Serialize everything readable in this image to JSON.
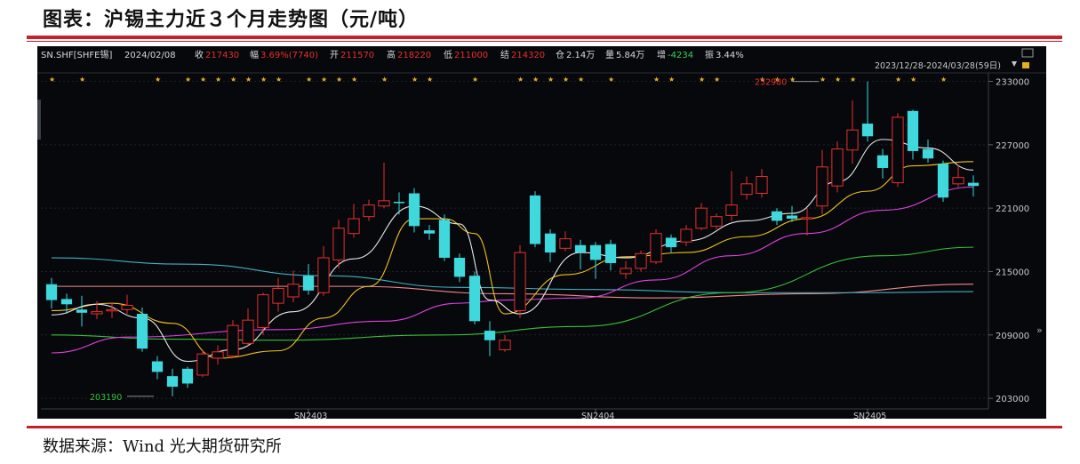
{
  "page": {
    "title": "图表：沪锡主力近３个月走势图（元/吨）",
    "source": "数据来源：Wind 光大期货研究所"
  },
  "infobar": {
    "symbol": "SN.SHF[SHFE锡]",
    "date": "2024/02/08",
    "close_label": "收",
    "close": "217430",
    "amp_label": "幅",
    "amp": "3.69%(7740)",
    "open_label": "开",
    "open": "211570",
    "high_label": "高",
    "high": "218220",
    "low_label": "低",
    "low": "211000",
    "settle_label": "结",
    "settle": "214320",
    "oi_label": "仓",
    "oi": "2.14万",
    "vol_label": "量",
    "vol": "5.84万",
    "chg_label": "增",
    "chg": "-4234",
    "swing_label": "振",
    "swing": "3.44%",
    "range": "2023/12/28-2024/03/28(59日)"
  },
  "colors": {
    "up": "#e8302c",
    "down": "#3fd8dc",
    "ma5": "#e8e8e8",
    "ma10": "#f0c020",
    "ma20": "#e040e0",
    "ma40": "#38c038",
    "ma60": "#44b0c0",
    "ma120": "#f08a8a"
  },
  "chart_data": {
    "type": "candlestick",
    "ylim": [
      202000,
      233800
    ],
    "yticks": [
      "233000",
      "227000",
      "221000",
      "215000",
      "209000",
      "203000"
    ],
    "contract_labels": [
      {
        "label": "SN2403",
        "at_index": 17
      },
      {
        "label": "SN2404",
        "at_index": 36
      },
      {
        "label": "SN2405",
        "at_index": 54
      }
    ],
    "annotations": [
      {
        "text": "232980",
        "index": 51,
        "value": 232980
      },
      {
        "text": "203190",
        "index": 7,
        "value": 203190
      }
    ],
    "candles": [
      [
        213800,
        212300,
        214400,
        211500
      ],
      [
        212400,
        211900,
        212900,
        211000
      ],
      [
        211400,
        211100,
        212700,
        209800
      ],
      [
        211000,
        211200,
        212200,
        210500
      ],
      [
        211300,
        211400,
        212100,
        210600
      ],
      [
        211400,
        211800,
        212800,
        211000
      ],
      [
        211000,
        207700,
        211600,
        207400
      ],
      [
        206500,
        205500,
        207000,
        204800
      ],
      [
        205100,
        204100,
        205800,
        203190
      ],
      [
        205800,
        204400,
        206000,
        204000
      ],
      [
        205200,
        207200,
        207600,
        205000
      ],
      [
        206800,
        207400,
        208000,
        206200
      ],
      [
        207000,
        209900,
        210400,
        206800
      ],
      [
        208200,
        210400,
        211500,
        208000
      ],
      [
        209700,
        212800,
        213000,
        209000
      ],
      [
        212000,
        213400,
        214400,
        211200
      ],
      [
        212600,
        213800,
        215100,
        212100
      ],
      [
        214600,
        213200,
        215700,
        212800
      ],
      [
        213000,
        216300,
        217400,
        212700
      ],
      [
        216100,
        219100,
        219900,
        215300
      ],
      [
        218600,
        220000,
        221400,
        218200
      ],
      [
        220200,
        221300,
        221800,
        219800
      ],
      [
        221200,
        221700,
        225300,
        221000
      ],
      [
        221600,
        221500,
        222500,
        220400
      ],
      [
        222400,
        219300,
        222900,
        218700
      ],
      [
        218900,
        218600,
        219400,
        218000
      ],
      [
        219900,
        216300,
        220400,
        216000
      ],
      [
        216300,
        214500,
        216700,
        214000
      ],
      [
        214600,
        210300,
        215000,
        210000
      ],
      [
        209400,
        208500,
        210300,
        207000
      ],
      [
        207600,
        208500,
        209000,
        207400
      ],
      [
        211300,
        216800,
        217500,
        210600
      ],
      [
        222200,
        217600,
        222600,
        217300
      ],
      [
        218600,
        216800,
        219000,
        215900
      ],
      [
        217200,
        218100,
        218800,
        216900
      ],
      [
        217500,
        216800,
        218000,
        215200
      ],
      [
        217500,
        216100,
        217800,
        214300
      ],
      [
        217600,
        215800,
        218000,
        215100
      ],
      [
        214800,
        215300,
        216000,
        214300
      ],
      [
        215300,
        216700,
        217000,
        215000
      ],
      [
        215900,
        218600,
        219000,
        215700
      ],
      [
        218200,
        217300,
        218500,
        216800
      ],
      [
        217800,
        219000,
        219400,
        217400
      ],
      [
        219100,
        221000,
        221500,
        218900
      ],
      [
        219300,
        220200,
        220500,
        219000
      ],
      [
        220300,
        221300,
        224500,
        219800
      ],
      [
        222300,
        223300,
        224000,
        221800
      ],
      [
        222400,
        224000,
        224700,
        222000
      ],
      [
        220700,
        219800,
        221000,
        219400
      ],
      [
        220300,
        220000,
        221200,
        219700
      ],
      [
        220100,
        220100,
        221000,
        218400
      ],
      [
        221200,
        224900,
        226500,
        220400
      ],
      [
        223100,
        226600,
        227300,
        222500
      ],
      [
        226500,
        228400,
        231200,
        225200
      ],
      [
        229000,
        227800,
        232980,
        227300
      ],
      [
        226000,
        224800,
        226600,
        223800
      ],
      [
        223400,
        229600,
        230000,
        223000
      ],
      [
        230200,
        226400,
        230300,
        225600
      ],
      [
        226600,
        225700,
        227500,
        225300
      ],
      [
        225200,
        222000,
        225500,
        221600
      ],
      [
        223300,
        223900,
        225100,
        223000
      ],
      [
        223400,
        223100,
        224100,
        222100
      ]
    ],
    "ma_lines": [
      {
        "name": "MA5",
        "color_key": "ma5"
      },
      {
        "name": "MA10",
        "color_key": "ma10"
      },
      {
        "name": "MA20",
        "color_key": "ma20"
      },
      {
        "name": "MA40",
        "color_key": "ma40"
      },
      {
        "name": "MA60",
        "color_key": "ma60"
      },
      {
        "name": "MA120",
        "color_key": "ma120"
      }
    ],
    "ma60_values": [
      [
        0,
        216300
      ],
      [
        9,
        215700
      ],
      [
        18,
        214600
      ],
      [
        27,
        213500
      ],
      [
        36,
        213300
      ],
      [
        45,
        213000
      ],
      [
        54,
        213000
      ],
      [
        61,
        213100
      ]
    ],
    "ma120_values": [
      [
        0,
        213600
      ],
      [
        20,
        213600
      ],
      [
        30,
        212900
      ],
      [
        40,
        212500
      ],
      [
        50,
        212900
      ],
      [
        61,
        213800
      ]
    ],
    "ma40_values": [
      [
        0,
        209000
      ],
      [
        8,
        208600
      ],
      [
        15,
        208500
      ],
      [
        26,
        209000
      ],
      [
        35,
        209800
      ],
      [
        45,
        213000
      ],
      [
        55,
        216500
      ],
      [
        61,
        217300
      ]
    ],
    "ma20_values": [
      [
        0,
        207300
      ],
      [
        5,
        208800
      ],
      [
        15,
        209500
      ],
      [
        22,
        210300
      ],
      [
        27,
        212000
      ],
      [
        30,
        212300
      ],
      [
        35,
        212500
      ],
      [
        40,
        214200
      ],
      [
        45,
        216500
      ],
      [
        50,
        218600
      ],
      [
        55,
        220800
      ],
      [
        61,
        223000
      ]
    ],
    "ma10_values": [
      [
        0,
        211300
      ],
      [
        4,
        212000
      ],
      [
        8,
        210100
      ],
      [
        11,
        206800
      ],
      [
        15,
        207500
      ],
      [
        18,
        210600
      ],
      [
        21,
        213600
      ],
      [
        24,
        220000
      ],
      [
        26,
        220000
      ],
      [
        28,
        218600
      ],
      [
        30,
        211000
      ],
      [
        34,
        214700
      ],
      [
        38,
        216400
      ],
      [
        42,
        216800
      ],
      [
        46,
        218300
      ],
      [
        50,
        220000
      ],
      [
        54,
        222600
      ],
      [
        57,
        225000
      ],
      [
        61,
        225400
      ]
    ],
    "ma5_values": [
      [
        0,
        210900
      ],
      [
        3,
        211900
      ],
      [
        6,
        210600
      ],
      [
        9,
        206500
      ],
      [
        12,
        207600
      ],
      [
        16,
        211200
      ],
      [
        20,
        216200
      ],
      [
        24,
        221200
      ],
      [
        27,
        219500
      ],
      [
        29,
        212300
      ],
      [
        31,
        211000
      ],
      [
        35,
        216800
      ],
      [
        38,
        216300
      ],
      [
        42,
        217900
      ],
      [
        46,
        219800
      ],
      [
        49,
        220500
      ],
      [
        52,
        223500
      ],
      [
        55,
        227500
      ],
      [
        58,
        226700
      ],
      [
        61,
        224600
      ]
    ],
    "stars": [
      0,
      2,
      7,
      9,
      10,
      11,
      12,
      13,
      14,
      15,
      17,
      18,
      19,
      20,
      22,
      24,
      25,
      28,
      31,
      32,
      33,
      34,
      35,
      37,
      40,
      41,
      43,
      44,
      47,
      48,
      49,
      51,
      52,
      53,
      56,
      57,
      59
    ]
  }
}
